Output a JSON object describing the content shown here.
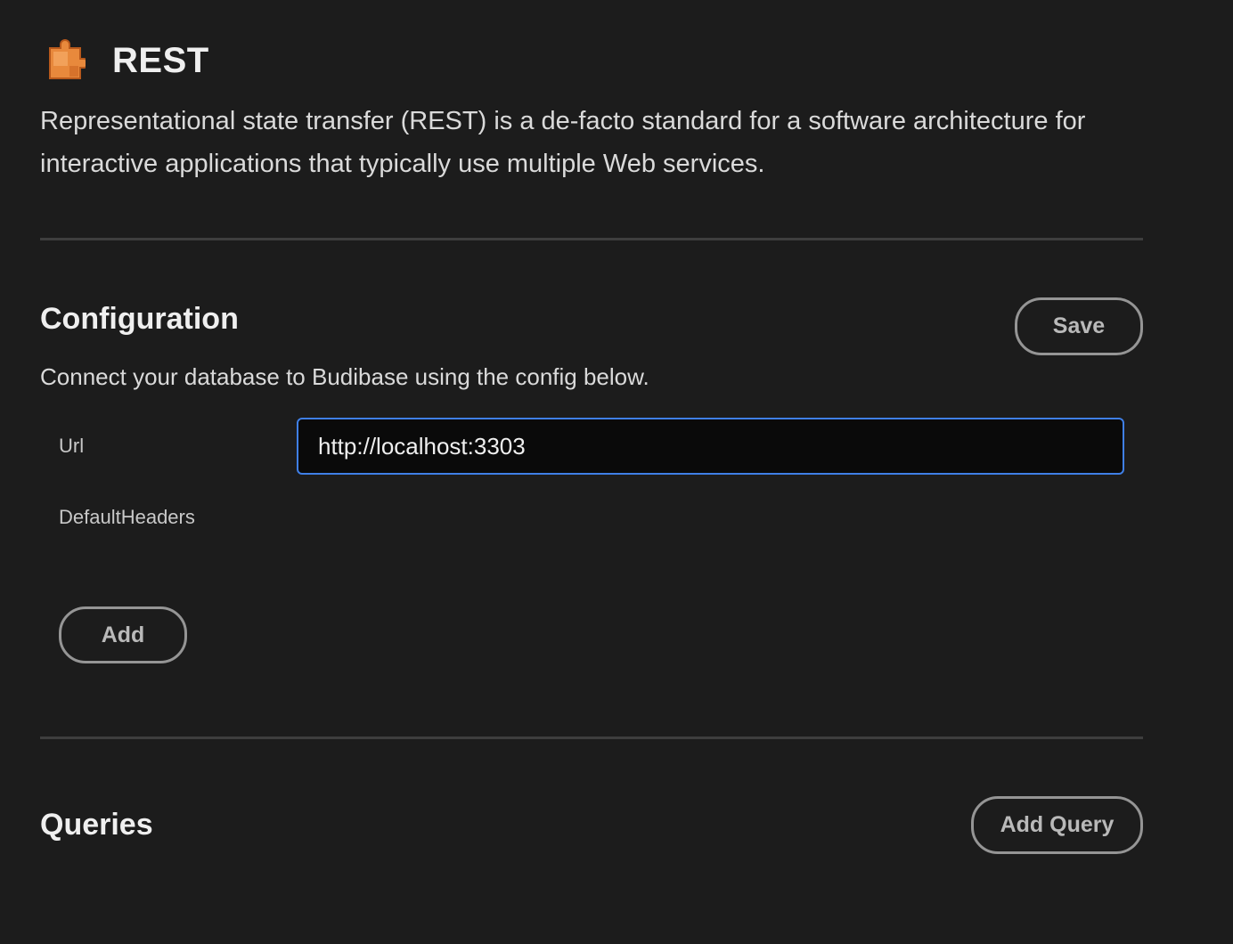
{
  "header": {
    "icon": "puzzle-icon",
    "title": "REST",
    "description": "Representational state transfer (REST) is a de-facto standard for a software architecture for interactive applications that typically use multiple Web services."
  },
  "configuration": {
    "heading": "Configuration",
    "save_label": "Save",
    "subtext": "Connect your database to Budibase using the config below.",
    "fields": {
      "url": {
        "label": "Url",
        "value": "http://localhost:3303"
      },
      "default_headers": {
        "label": "DefaultHeaders",
        "add_label": "Add"
      }
    }
  },
  "queries": {
    "heading": "Queries",
    "add_query_label": "Add Query"
  },
  "colors": {
    "background": "#1c1c1c",
    "icon_orange": "#e8893c",
    "input_focus_border": "#3f7fe6",
    "button_border": "#959595"
  }
}
